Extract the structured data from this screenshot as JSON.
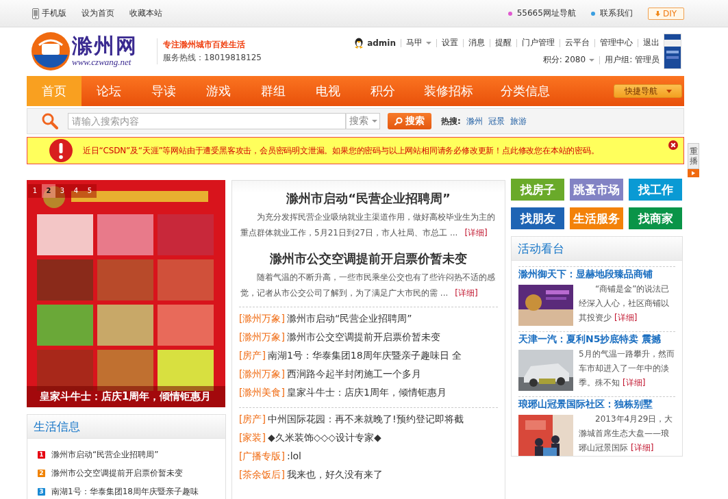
{
  "top_bar": {
    "left_links": [
      {
        "label": "手机版",
        "kind": "phone"
      },
      {
        "label": "设为首页",
        "kind": "text"
      },
      {
        "label": "收藏本站",
        "kind": "text"
      }
    ],
    "right_links": [
      {
        "label": "55665网址导航",
        "color": "#e05ad0"
      },
      {
        "label": "联系我们",
        "color": "#3a9ee0"
      }
    ],
    "diy_button": "DIY"
  },
  "header": {
    "logo": {
      "name": "滁州网",
      "url": "www.czwang.net"
    },
    "slogan": "专注滁州城市百姓生活",
    "hotline": "服务热线：18019818125",
    "user": {
      "name": "admin"
    },
    "menu": [
      {
        "label": "马甲",
        "dropdown": true
      },
      {
        "label": "设置",
        "dropdown": false
      },
      {
        "label": "消息",
        "dropdown": false
      },
      {
        "label": "提醒",
        "dropdown": false
      },
      {
        "label": "门户管理",
        "dropdown": false
      },
      {
        "label": "云平台",
        "dropdown": false
      },
      {
        "label": "管理中心",
        "dropdown": false
      },
      {
        "label": "退出",
        "dropdown": false
      }
    ],
    "points": {
      "label": "积分: 2080",
      "dropdown": true
    },
    "user_group": "用户组: 管理员"
  },
  "nav": {
    "items": [
      {
        "label": "首页",
        "selected": true
      },
      {
        "label": "论坛",
        "selected": false
      },
      {
        "label": "导读",
        "selected": false
      },
      {
        "label": "游戏",
        "selected": false
      },
      {
        "label": "群组",
        "selected": false
      },
      {
        "label": "电视",
        "selected": false
      },
      {
        "label": "积分",
        "selected": false
      },
      {
        "label": "装修招标",
        "selected": false
      },
      {
        "label": "分类信息",
        "selected": false
      }
    ],
    "quick_nav": "快捷导航"
  },
  "search": {
    "placeholder": "请输入搜索内容",
    "scope": "搜索",
    "button": "搜索",
    "hot_label": "热搜:",
    "hot_terms": [
      "滁州",
      "冠景",
      "旅游"
    ]
  },
  "alert": {
    "text": "近日“CSDN”及“天涯”等网站由于遭受黑客攻击，会员密码明文泄漏。如果您的密码与以上网站相同请务必修改更新！点此修改您在本站的密码。"
  },
  "replay_tab": "重播",
  "slideshow": {
    "pages": [
      {
        "label": "1",
        "selected": false
      },
      {
        "label": "2",
        "selected": true
      },
      {
        "label": "3",
        "selected": false
      },
      {
        "label": "4",
        "selected": false
      },
      {
        "label": "5",
        "selected": false
      }
    ],
    "caption": "皇家斗牛士：店庆1周年，倾情钜惠月"
  },
  "life_info": {
    "title": "生活信息",
    "items": [
      {
        "rank": "1",
        "color": "#e60012",
        "text": "滁州市启动“民营企业招聘周”"
      },
      {
        "rank": "2",
        "color": "#f08200",
        "text": "滁州市公交空调提前开启票价暂未变"
      },
      {
        "rank": "3",
        "color": "#1a8ad4",
        "text": "南湖1号：华泰集团18周年庆暨亲子趣味"
      }
    ]
  },
  "headlines": [
    {
      "title": "滁州市启动“民营企业招聘周”",
      "summary": "为充分发挥民营企业吸纳就业主渠道作用，做好高校毕业生为主的重点群体就业工作，5月21日到27日，市人社局、市总工 ...",
      "more": "[详细]"
    },
    {
      "title": "滁州市公交空调提前开启票价暂未变",
      "summary": "随着气温的不断升高，一些市民乘坐公交也有了些许闷热不适的感觉，记者从市公交公司了解到，为了满足广大市民的需 ...",
      "more": "[详细]"
    }
  ],
  "news_lists": [
    [
      {
        "category": "[滁州万象]",
        "title": "滁州市启动“民营企业招聘周”"
      },
      {
        "category": "[滁州万象]",
        "title": "滁州市公交空调提前开启票价暂未变"
      },
      {
        "category": "[房产]",
        "title": "南湖1号：华泰集团18周年庆暨亲子趣味日 全"
      },
      {
        "category": "[滁州万象]",
        "title": "西涧路今起半封闭施工一个多月"
      },
      {
        "category": "[滁州美食]",
        "title": "皇家斗牛士：店庆1周年，倾情钜惠月"
      }
    ],
    [
      {
        "category": "[房产]",
        "title": "中州国际花园：再不来就晚了!预约登记即将截"
      },
      {
        "category": "[家装]",
        "title": "◆久米装饰◇◇◇设计专家◆"
      },
      {
        "category": "[广播专版]",
        "title": ":lol"
      },
      {
        "category": "[茶余饭后]",
        "title": "我来也，好久没有来了"
      }
    ]
  ],
  "quick_links": [
    {
      "label": "找房子",
      "color": "#6aaa2a"
    },
    {
      "label": "跳蚤市场",
      "color": "#8283c4"
    },
    {
      "label": "找工作",
      "color": "#0a9ad4"
    },
    {
      "label": "找朋友",
      "color": "#1e64b4"
    },
    {
      "label": "生活服务",
      "color": "#f38209"
    },
    {
      "label": "找商家",
      "color": "#0a9448"
    }
  ],
  "activities": {
    "title": "活动看台",
    "items": [
      {
        "title": "滁州御天下：显赫地段臻品商铺",
        "summary": "“商铺是金”的说法已经深入人心，社区商铺以其投资少",
        "indent": true,
        "more": "[详细]"
      },
      {
        "title": "天津一汽：夏利N5抄底特卖 震撼",
        "summary": "5月的气温一路攀升，然而车市却进入了一年中的淡季。殊不知",
        "indent": false,
        "more": "[详细]"
      },
      {
        "title": "琅琊山冠景国际社区：独栋别墅",
        "summary": "2013年4月29日，大滁城首席生态大盘——琅琊山冠景国际",
        "indent": true,
        "more": "[详细]"
      }
    ]
  }
}
